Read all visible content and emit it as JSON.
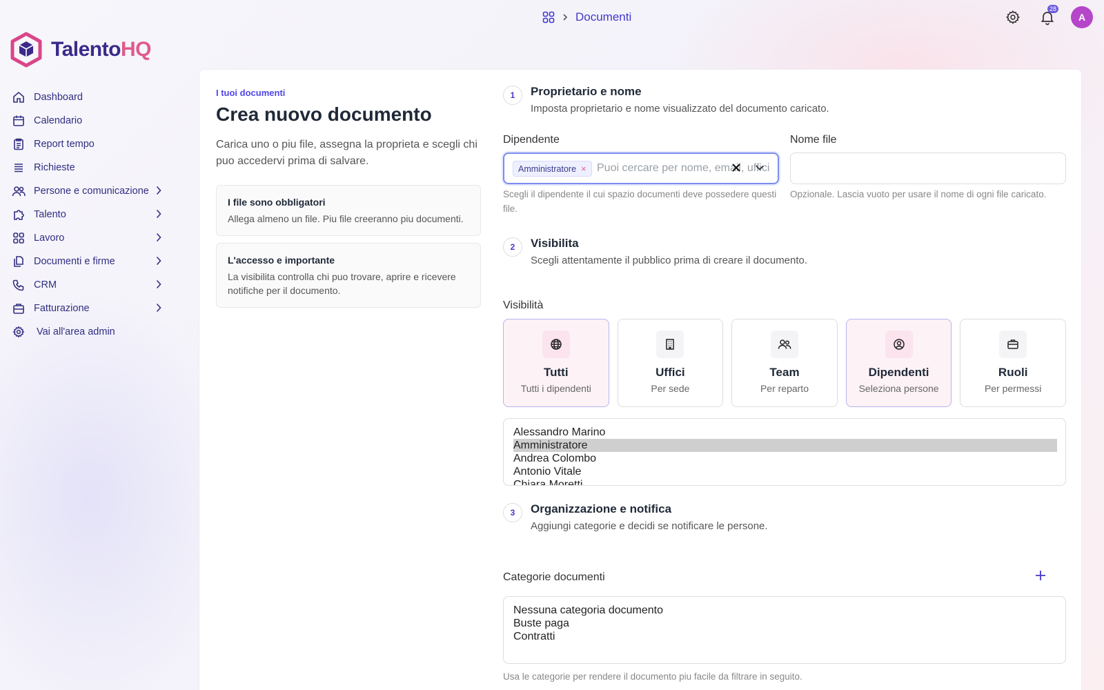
{
  "breadcrumb": {
    "current": "Documenti"
  },
  "header": {
    "notification_count": "28",
    "avatar_initial": "A"
  },
  "logo": {
    "part1": "Talento",
    "part2": "HQ"
  },
  "sidebar": {
    "items": [
      {
        "label": "Dashboard",
        "icon": "home-icon",
        "has_children": false
      },
      {
        "label": "Calendario",
        "icon": "calendar-icon",
        "has_children": false
      },
      {
        "label": "Report tempo",
        "icon": "report-icon",
        "has_children": false
      },
      {
        "label": "Richieste",
        "icon": "list-icon",
        "has_children": false
      },
      {
        "label": "Persone e comunicazione",
        "icon": "people-icon",
        "has_children": true
      },
      {
        "label": "Talento",
        "icon": "puzzle-icon",
        "has_children": true
      },
      {
        "label": "Lavoro",
        "icon": "grid-icon",
        "has_children": true
      },
      {
        "label": "Documenti e firme",
        "icon": "documents-icon",
        "has_children": true
      },
      {
        "label": "CRM",
        "icon": "phone-icon",
        "has_children": true
      },
      {
        "label": "Fatturazione",
        "icon": "billing-icon",
        "has_children": true
      },
      {
        "label": "Vai all'area admin",
        "icon": "gear-icon",
        "has_children": false
      }
    ]
  },
  "intro": {
    "eyebrow": "I tuoi documenti",
    "title": "Crea nuovo documento",
    "description": "Carica uno o piu file, assegna la proprieta e scegli chi puo accedervi prima di salvare.",
    "boxes": [
      {
        "title": "I file sono obbligatori",
        "text": "Allega almeno un file. Piu file creeranno piu documenti."
      },
      {
        "title": "L'accesso e importante",
        "text": "La visibilita controlla chi puo trovare, aprire e ricevere notifiche per il documento."
      }
    ]
  },
  "step1": {
    "number": "1",
    "title": "Proprietario e nome",
    "subtitle": "Imposta proprietario e nome visualizzato del documento caricato.",
    "employee": {
      "label": "Dipendente",
      "chip": "Amministratore",
      "placeholder": "Puoi cercare per nome, email, ufficio",
      "hint": "Scegli il dipendente il cui spazio documenti deve possedere questi file."
    },
    "filename": {
      "label": "Nome file",
      "value": "",
      "hint": "Opzionale. Lascia vuoto per usare il nome di ogni file caricato."
    }
  },
  "step2": {
    "number": "2",
    "title": "Visibilita",
    "subtitle": "Scegli attentamente il pubblico prima di creare il documento.",
    "label": "Visibilità",
    "options": [
      {
        "name": "Tutti",
        "sub": "Tutti i dipendenti",
        "icon": "globe-icon",
        "selected": true
      },
      {
        "name": "Uffici",
        "sub": "Per sede",
        "icon": "building-icon",
        "selected": false
      },
      {
        "name": "Team",
        "sub": "Per reparto",
        "icon": "users-icon",
        "selected": false
      },
      {
        "name": "Dipendenti",
        "sub": "Seleziona persone",
        "icon": "user-circle-icon",
        "selected": true
      },
      {
        "name": "Ruoli",
        "sub": "Per permessi",
        "icon": "briefcase-icon",
        "selected": false
      }
    ],
    "people": [
      "Alessandro Marino",
      "Amministratore",
      "Andrea Colombo",
      "Antonio Vitale",
      "Chiara Moretti"
    ],
    "people_selected": "Amministratore"
  },
  "step3": {
    "number": "3",
    "title": "Organizzazione e notifica",
    "subtitle": "Aggiungi categorie e decidi se notificare le persone.",
    "categories_label": "Categorie documenti",
    "categories": [
      "Nessuna categoria documento",
      "Buste paga",
      "Contratti"
    ],
    "categories_hint": "Usa le categorie per rendere il documento piu facile da filtrare in seguito."
  },
  "colors": {
    "accent": "#4338ca",
    "brand_pink": "#e05a8a",
    "brand_dark": "#3b2a8a",
    "avatar": "#b646c9"
  }
}
